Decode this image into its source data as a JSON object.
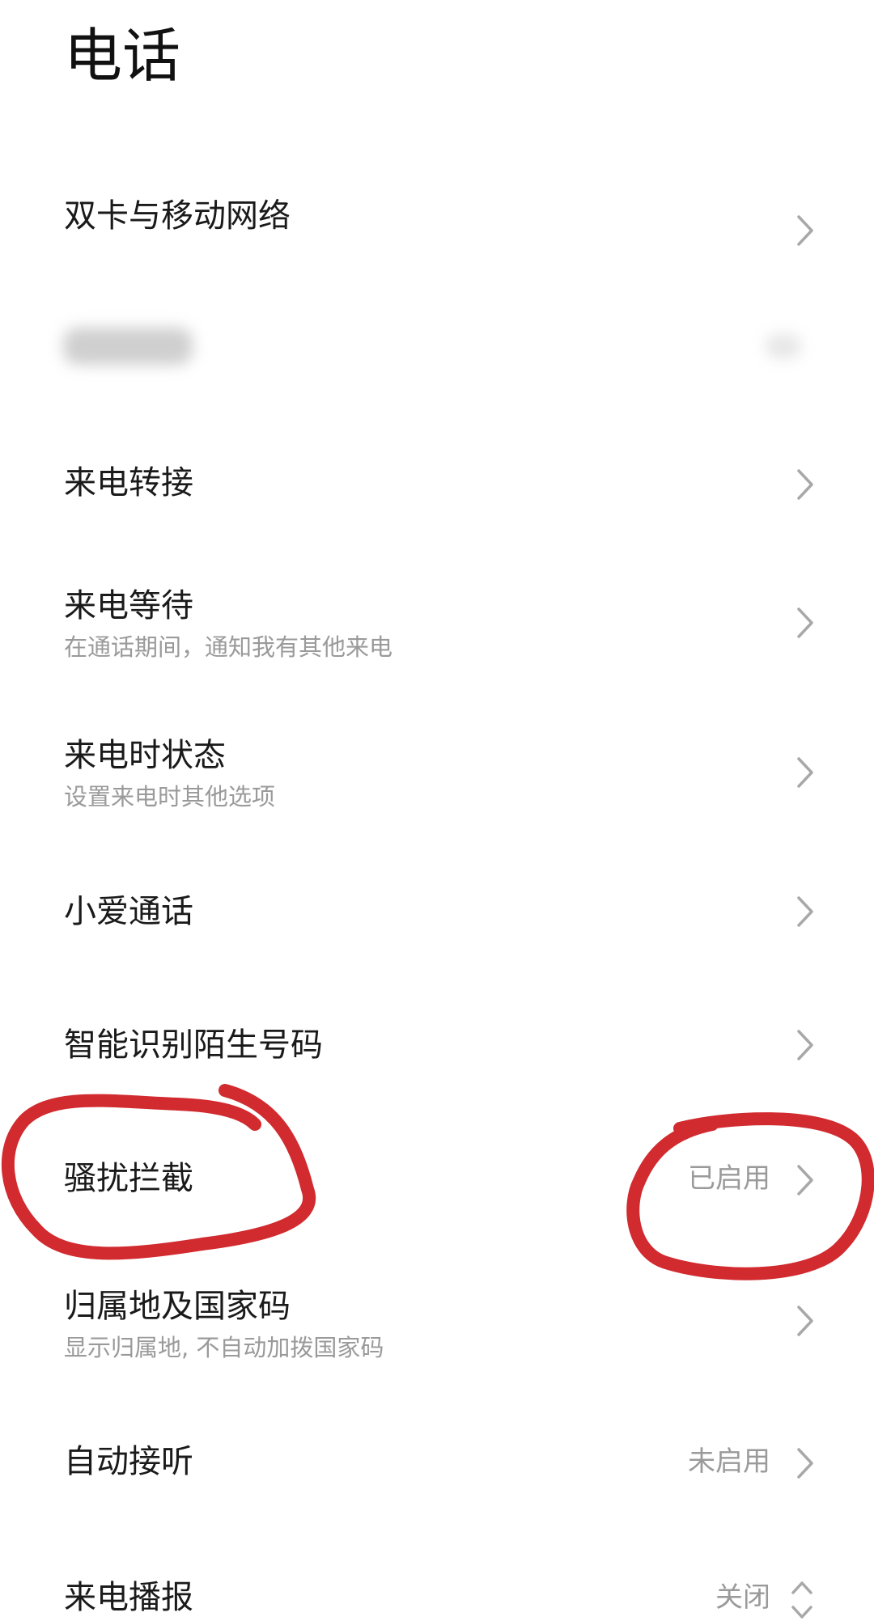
{
  "header": {
    "title": "电话"
  },
  "settings": {
    "dual_sim": {
      "label": "双卡与移动网络"
    },
    "redacted": {
      "label": ""
    },
    "call_forwarding": {
      "label": "来电转接"
    },
    "call_waiting": {
      "label": "来电等待",
      "subtitle": "在通话期间，通知我有其他来电"
    },
    "incoming_state": {
      "label": "来电时状态",
      "subtitle": "设置来电时其他选项"
    },
    "xiaoai_call": {
      "label": "小爱通话"
    },
    "identify_unknown": {
      "label": "智能识别陌生号码"
    },
    "spam_block": {
      "label": "骚扰拦截",
      "value": "已启用"
    },
    "location_code": {
      "label": "归属地及国家码",
      "subtitle": "显示归属地, 不自动加拨国家码"
    },
    "auto_answer": {
      "label": "自动接听",
      "value": "未启用"
    },
    "caller_announce": {
      "label": "来电播报",
      "value": "关闭"
    }
  },
  "colors": {
    "annotation": "#d12a2f",
    "secondary_text": "#9a9a9a",
    "chevron": "#a8a8a8"
  },
  "icons": {
    "chevron": "chevron-right-icon",
    "updown": "chevron-up-down-icon"
  }
}
